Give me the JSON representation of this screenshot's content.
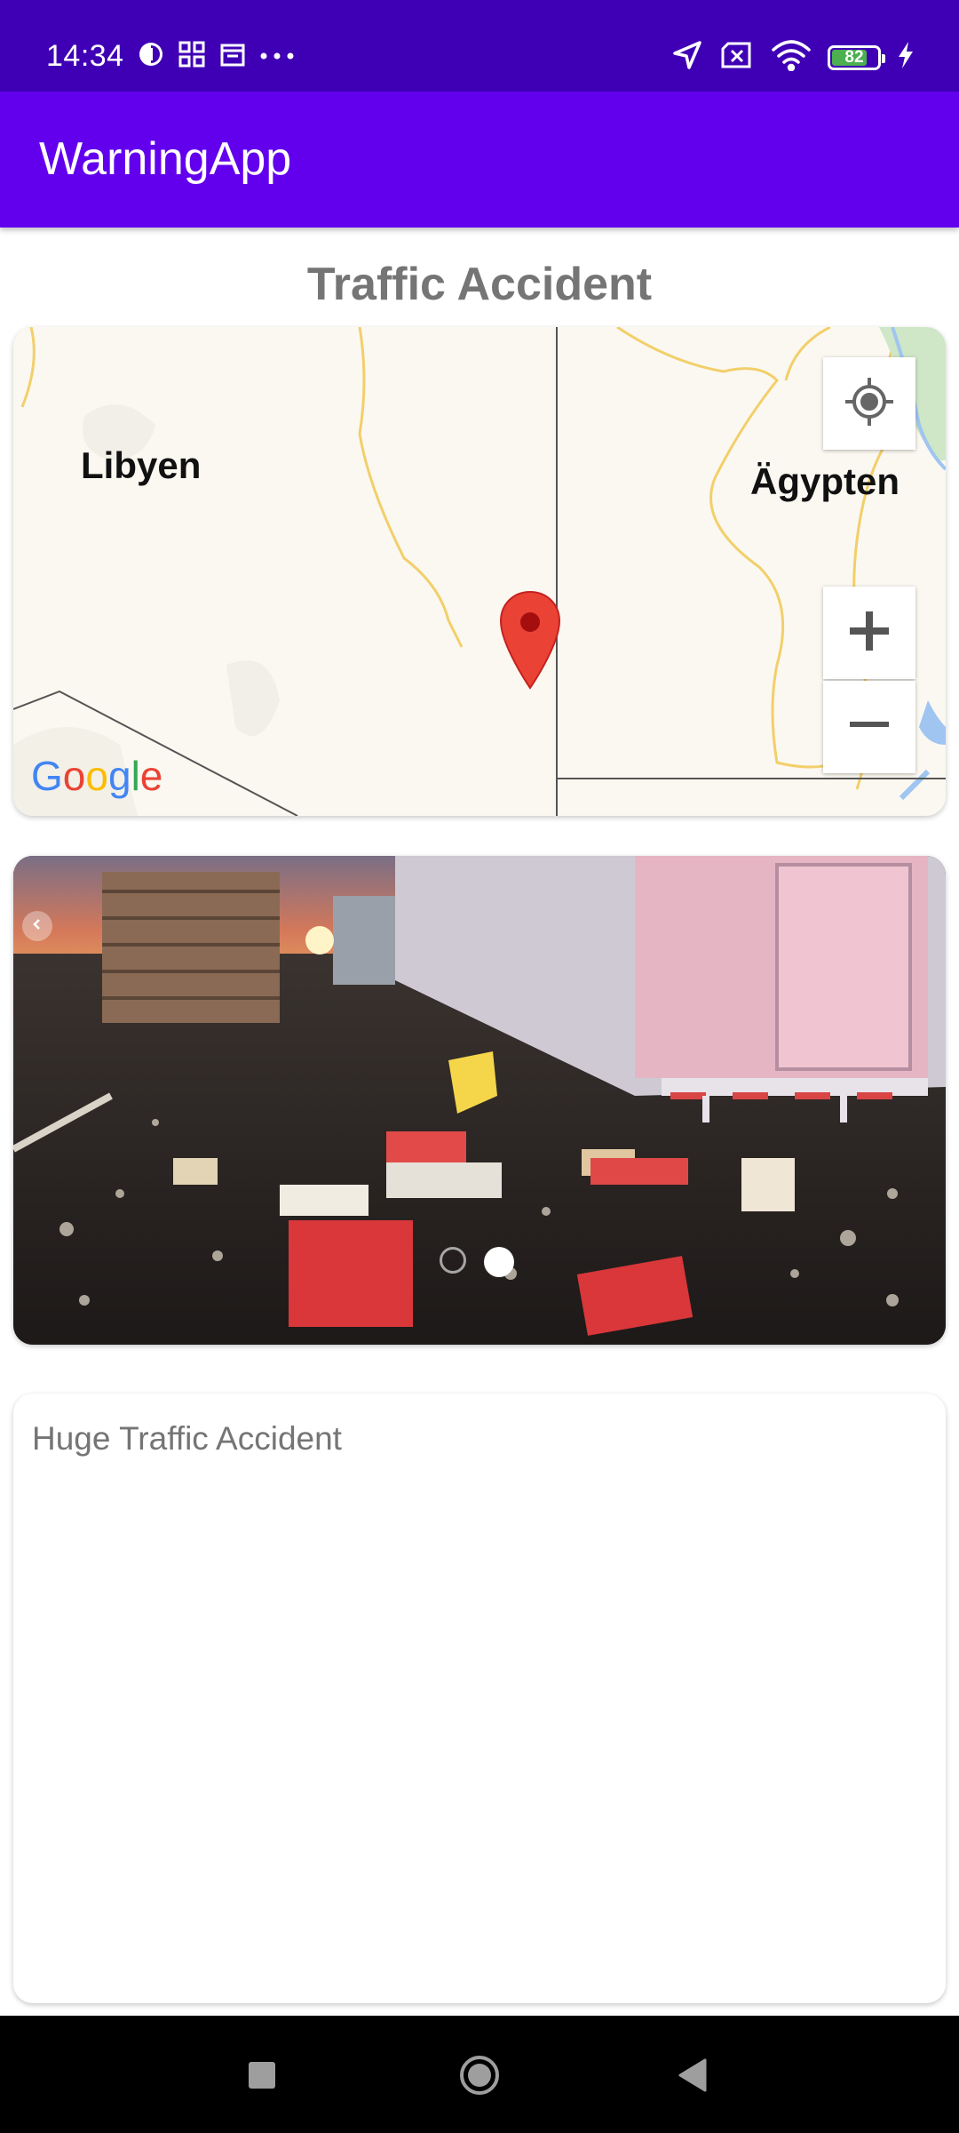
{
  "status_bar": {
    "time": "14:34",
    "battery_level": "82",
    "battery_fraction": 0.82,
    "icons": [
      "data-saver-icon",
      "apps-grid-icon",
      "calendar-icon",
      "more-dots-icon",
      "location-arrow-icon",
      "no-sim-icon",
      "wifi-icon",
      "battery-icon",
      "charging-bolt-icon"
    ]
  },
  "app_bar": {
    "title": "WarningApp"
  },
  "page": {
    "title": "Traffic Accident"
  },
  "map": {
    "country_left": "Libyen",
    "country_right": "Ägypten",
    "provider": "Google",
    "controls": [
      "my-location-button",
      "zoom-in-button",
      "zoom-out-button"
    ]
  },
  "photo": {
    "slide_count": 2,
    "active_slide": 2,
    "colors": {
      "sky": "#d4785a",
      "road": "#2a2422"
    }
  },
  "description": {
    "text": "Huge Traffic Accident"
  },
  "nav_bar": {
    "buttons": [
      "recents-button",
      "home-button",
      "back-button"
    ]
  },
  "colors": {
    "status_bar": "#3f00b5",
    "app_bar": "#6200ee",
    "title_text": "#757575",
    "map_marker": "#ea4335"
  }
}
